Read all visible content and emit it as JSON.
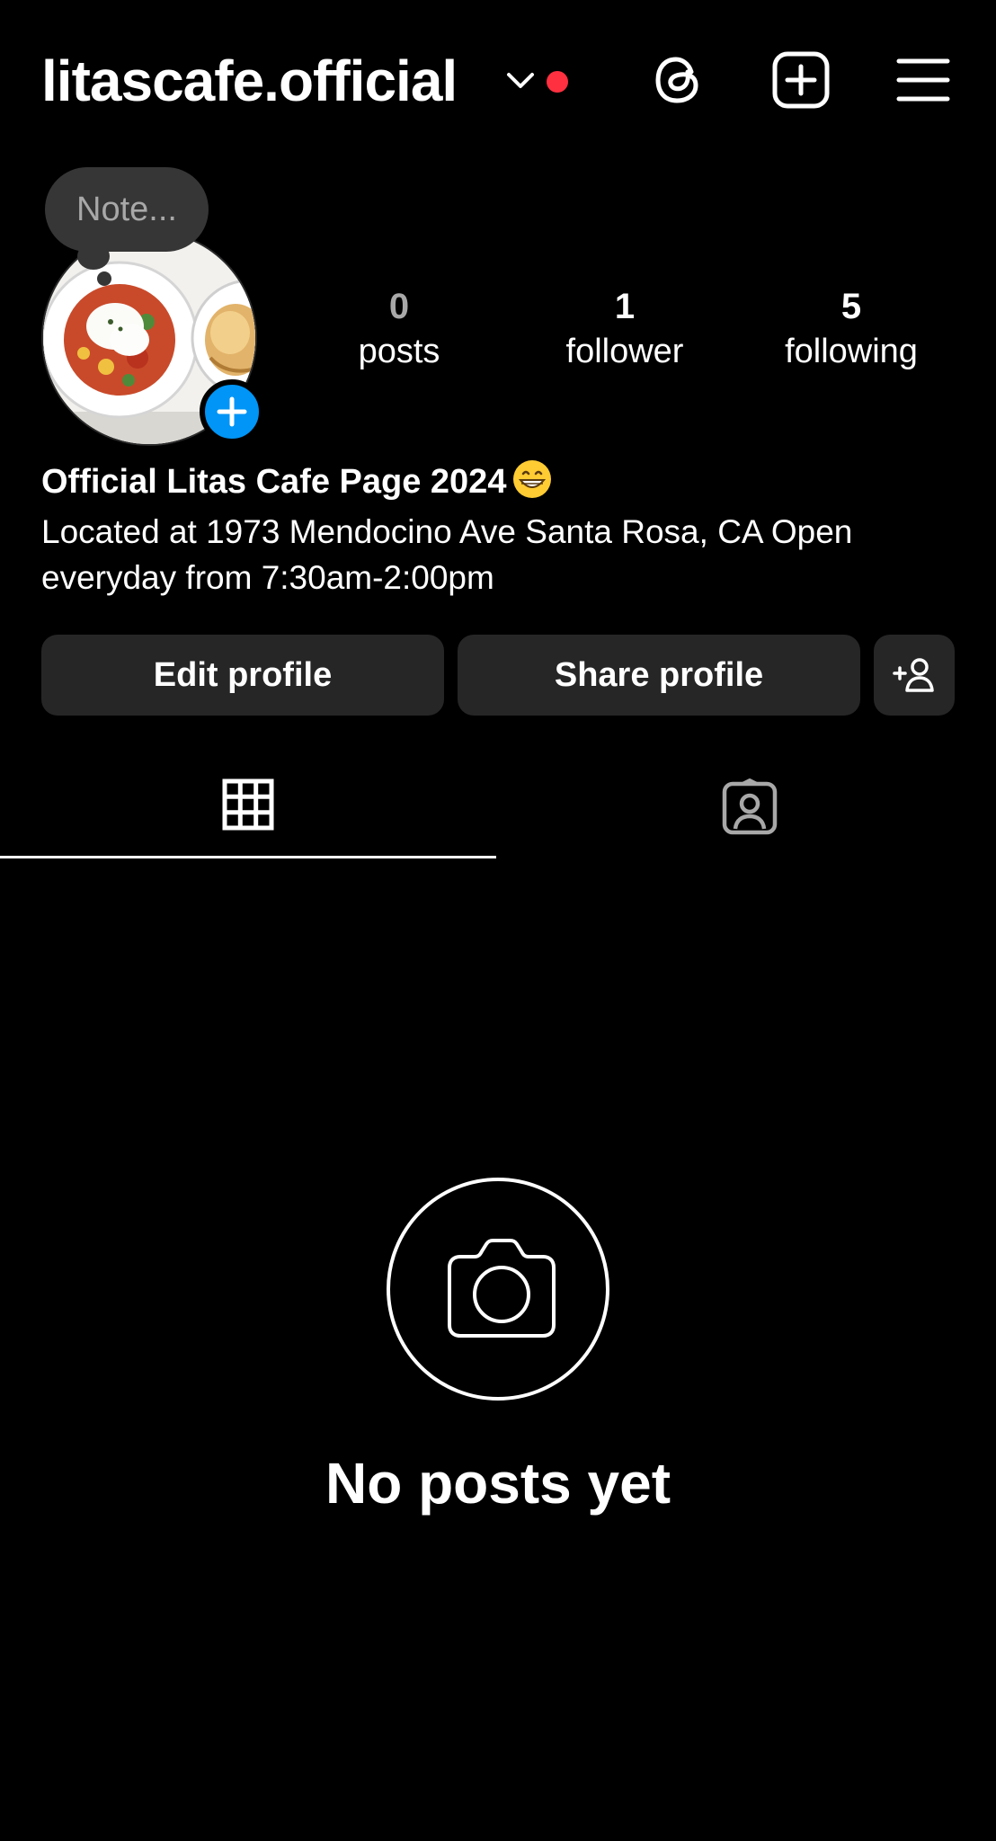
{
  "header": {
    "username": "litascafe.official",
    "notification_color": "#ff3040",
    "icons": [
      "chevron-down-icon",
      "threads-icon",
      "create-post-icon",
      "menu-icon"
    ]
  },
  "profile": {
    "note_placeholder": "Note...",
    "add_story_color": "#0095f6",
    "stats": {
      "posts_count": "0",
      "posts_label": "posts",
      "followers_count": "1",
      "followers_label": "follower",
      "following_count": "5",
      "following_label": "following"
    },
    "bio_name": "Official Litas Cafe Page 2024",
    "bio_text": "Located at 1973 Mendocino Ave Santa Rosa, CA Open everyday from 7:30am-2:00pm"
  },
  "actions": {
    "edit_label": "Edit profile",
    "share_label": "Share profile",
    "suggest_icon": "add-person-icon"
  },
  "tabs": [
    {
      "icon": "grid-icon",
      "active": true
    },
    {
      "icon": "tagged-person-icon",
      "active": false
    }
  ],
  "empty_state": {
    "icon": "camera-icon",
    "message": "No posts yet"
  }
}
